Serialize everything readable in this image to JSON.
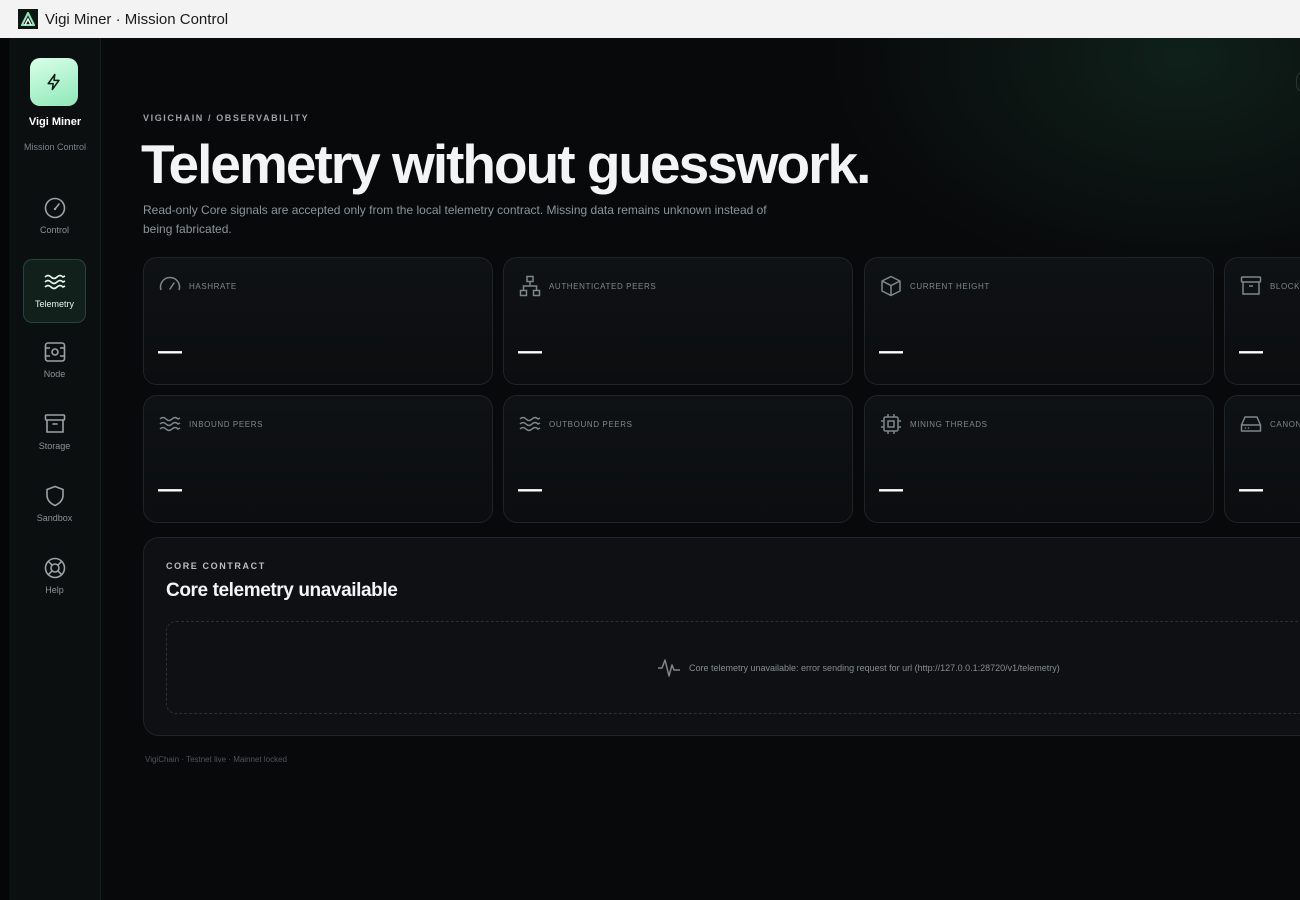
{
  "window": {
    "title": "Vigi Miner · Mission Control"
  },
  "sidebar": {
    "brand_name": "Vigi Miner",
    "brand_sub": "Mission Control",
    "items": [
      {
        "label": "Control",
        "icon": "gauge-icon",
        "active": false
      },
      {
        "label": "Telemetry",
        "icon": "waves-icon",
        "active": true
      },
      {
        "label": "Node",
        "icon": "server-icon",
        "active": false
      },
      {
        "label": "Storage",
        "icon": "archive-icon",
        "active": false
      },
      {
        "label": "Sandbox",
        "icon": "shield-icon",
        "active": false
      },
      {
        "label": "Help",
        "icon": "lifebuoy-icon",
        "active": false
      }
    ]
  },
  "header": {
    "eyebrow": "VIGICHAIN / OBSERVABILITY",
    "title": "Telemetry without guesswork.",
    "description": "Read-only Core signals are accepted only from the local telemetry contract. Missing data remains unknown instead of being fabricated."
  },
  "metrics": [
    {
      "label": "HASHRATE",
      "value": "—",
      "icon": "gauge-icon"
    },
    {
      "label": "AUTHENTICATED PEERS",
      "value": "—",
      "icon": "network-icon"
    },
    {
      "label": "CURRENT HEIGHT",
      "value": "—",
      "icon": "cube-icon"
    },
    {
      "label": "BLOCKS",
      "value": "—",
      "icon": "archive-icon"
    },
    {
      "label": "INBOUND PEERS",
      "value": "—",
      "icon": "waves-icon"
    },
    {
      "label": "OUTBOUND PEERS",
      "value": "—",
      "icon": "waves-icon"
    },
    {
      "label": "MINING THREADS",
      "value": "—",
      "icon": "cpu-icon"
    },
    {
      "label": "CANON",
      "value": "—",
      "icon": "hard-drive-icon"
    }
  ],
  "core": {
    "eyebrow": "CORE CONTRACT",
    "title": "Core telemetry unavailable",
    "message": "Core telemetry unavailable: error sending request for url (http://127.0.0.1:28720/v1/telemetry)"
  },
  "footer": {
    "text": "VigiChain · Testnet live · Mainnet locked"
  },
  "colors": {
    "accent": "#8fe8b8",
    "background": "#08090b",
    "card_border": "#1f2427"
  }
}
